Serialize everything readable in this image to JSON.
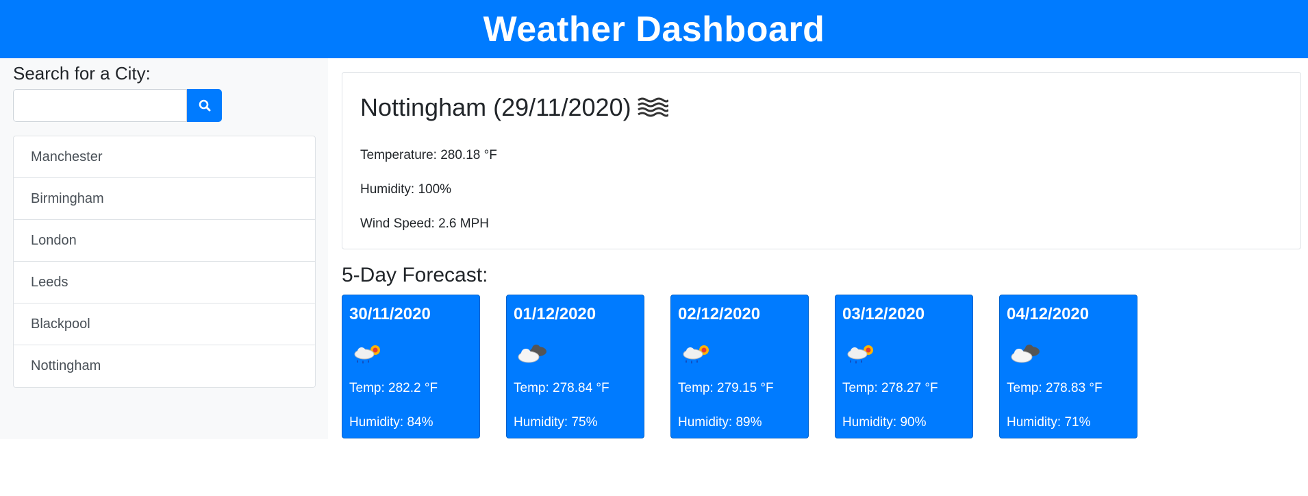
{
  "header": {
    "title": "Weather Dashboard"
  },
  "search": {
    "label": "Search for a City:",
    "input_value": "",
    "placeholder": "",
    "button_icon": "search-icon"
  },
  "cities": [
    "Manchester",
    "Birmingham",
    "London",
    "Leeds",
    "Blackpool",
    "Nottingham"
  ],
  "current": {
    "title": "Nottingham (29/11/2020)",
    "icon": "mist-icon",
    "temperature": "Temperature: 280.18 °F",
    "humidity": "Humidity: 100%",
    "wind": "Wind Speed: 2.6 MPH"
  },
  "forecast": {
    "heading": "5-Day Forecast:",
    "days": [
      {
        "date": "30/11/2020",
        "icon": "rain-sun-icon",
        "temp": "Temp: 282.2 °F",
        "humidity": "Humidity: 84%"
      },
      {
        "date": "01/12/2020",
        "icon": "cloudy-icon",
        "temp": "Temp: 278.84 °F",
        "humidity": "Humidity: 75%"
      },
      {
        "date": "02/12/2020",
        "icon": "rain-sun-icon",
        "temp": "Temp: 279.15 °F",
        "humidity": "Humidity: 89%"
      },
      {
        "date": "03/12/2020",
        "icon": "rain-sun-icon",
        "temp": "Temp: 278.27 °F",
        "humidity": "Humidity: 90%"
      },
      {
        "date": "04/12/2020",
        "icon": "cloudy-icon",
        "temp": "Temp: 278.83 °F",
        "humidity": "Humidity: 71%"
      }
    ]
  },
  "colors": {
    "primary": "#007bff",
    "sidebar_bg": "#f8f9fa",
    "border": "#dee2e6"
  }
}
